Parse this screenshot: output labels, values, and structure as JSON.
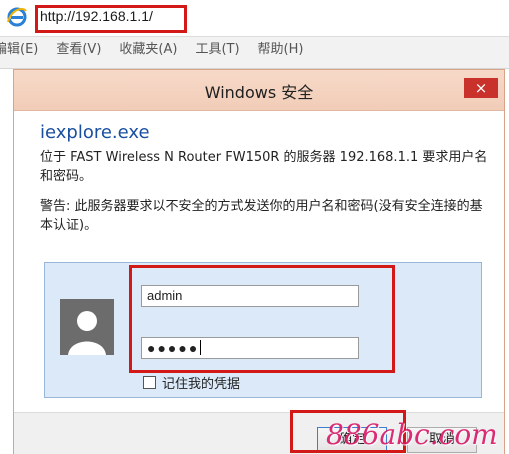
{
  "browser": {
    "url": "http://192.168.1.1/",
    "menu": [
      "编辑(E)",
      "查看(V)",
      "收藏夹(A)",
      "工具(T)",
      "帮助(H)"
    ]
  },
  "dialog": {
    "title": "Windows 安全",
    "close_label": "×",
    "app_name": "iexplore.exe",
    "message_1": "位于 FAST Wireless N Router FW150R 的服务器 192.168.1.1 要求用户名和密码。",
    "message_2": "警告: 此服务器要求以不安全的方式发送你的用户名和密码(没有安全连接的基本认证)。",
    "username_value": "admin",
    "password_value": "●●●●●",
    "remember_label": "记住我的凭据",
    "ok_label": "确定",
    "cancel_label": "取消"
  },
  "watermark": "886abc.com",
  "colors": {
    "highlight": "#d31818",
    "titlebar": "#f3d2bf",
    "panel": "#dbe9f9",
    "link_blue": "#1a4fa0"
  },
  "icons": {
    "browser": "ie-logo-icon",
    "avatar": "user-avatar-icon"
  }
}
